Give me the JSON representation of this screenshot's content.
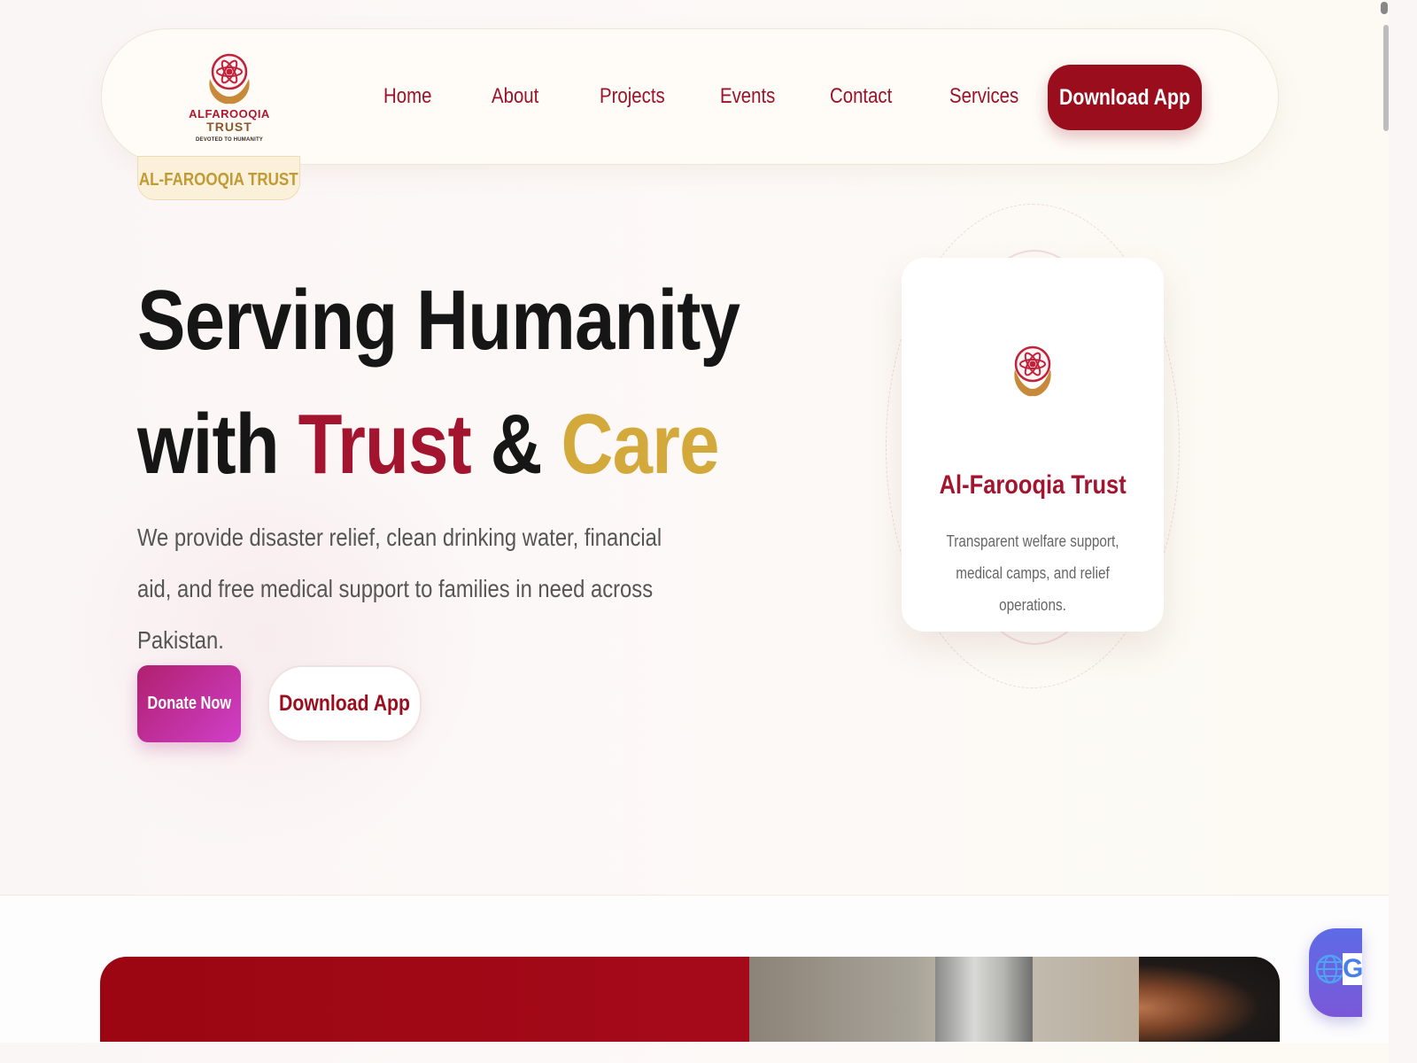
{
  "nav": {
    "logo": {
      "line1": "ALFAROOQIA",
      "line2": "TRUST",
      "tagline": "DEVOTED TO HUMANITY"
    },
    "links": [
      "Home",
      "About",
      "Projects",
      "Events",
      "Contact",
      "Services"
    ],
    "cta": "Download App"
  },
  "hero": {
    "badge": "AL-FAROOQIA TRUST",
    "headline_line1": "Serving Humanity",
    "headline_with": "with",
    "headline_trust": "Trust",
    "headline_amp": "&",
    "headline_care": "Care",
    "description": "We provide disaster relief, clean drinking water, financial aid, and free medical support to families in need across Pakistan.",
    "donate_button": "Donate Now",
    "download_button": "Download App"
  },
  "card": {
    "title": "Al-Farooqia Trust",
    "description": "Transparent welfare support, medical camps, and relief operations."
  },
  "widget": {
    "icon": "globe-icon",
    "letter": "G"
  },
  "colors": {
    "brand_red": "#9a0d1d",
    "trust_red": "#a3152f",
    "care_gold": "#d2a93a",
    "donate_gradient_start": "#b0206e",
    "donate_gradient_end": "#d03fc9"
  }
}
